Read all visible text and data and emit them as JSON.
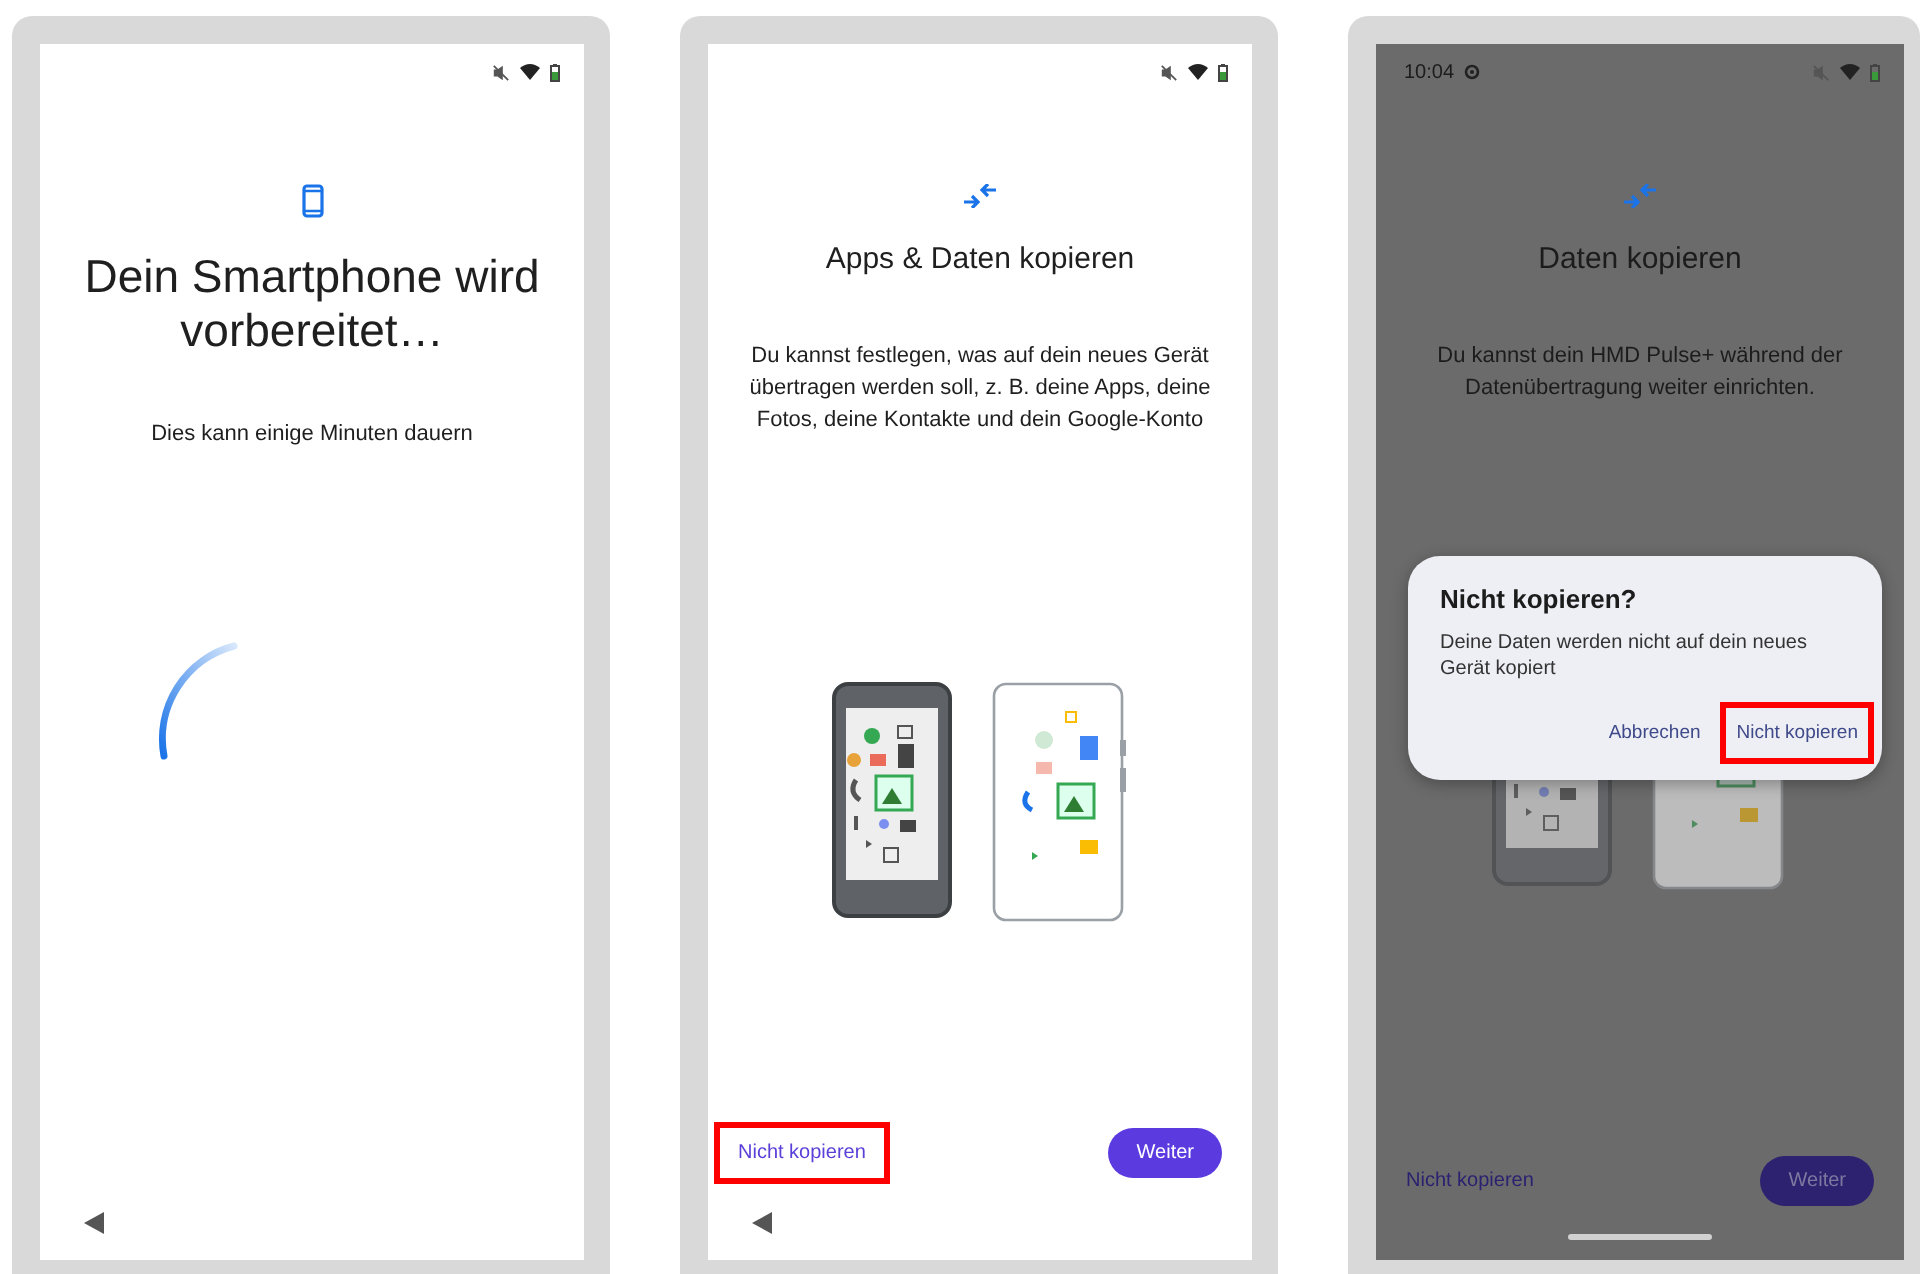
{
  "screens": [
    {
      "kind": "preparing",
      "dimmed": false,
      "title": "Dein Smartphone wird vorbereitet…",
      "subtitle": "Dies kann einige Minuten dauern",
      "nav_bar": {
        "kind": "back"
      }
    },
    {
      "kind": "copy",
      "dimmed": false,
      "title": "Apps & Daten kopieren",
      "body": "Du kannst festlegen, was auf dein neues Gerät übertragen werden soll, z. B. deine Apps, deine Fotos, deine Kontakte und dein Google-Konto",
      "secondary_button": {
        "label": "Nicht kopieren",
        "highlighted": true
      },
      "primary_button": {
        "label": "Weiter",
        "highlighted": false
      },
      "nav_bar": {
        "kind": "back"
      }
    },
    {
      "kind": "copy",
      "dimmed": true,
      "status_time": "10:04",
      "title": "Daten kopieren",
      "body": "Du kannst dein HMD Pulse+ während der Datenübertragung weiter einrichten.",
      "secondary_button": {
        "label": "Nicht kopieren",
        "highlighted": false
      },
      "primary_button": {
        "label": "Weiter",
        "highlighted": false
      },
      "nav_bar": {
        "kind": "gesture"
      },
      "dialog": {
        "title": "Nicht kopieren?",
        "body": "Deine Daten werden nicht auf dein neues Gerät kopiert",
        "buttons": [
          {
            "label": "Abbrechen",
            "highlighted": false
          },
          {
            "label": "Nicht kopieren",
            "highlighted": true
          }
        ]
      }
    }
  ]
}
